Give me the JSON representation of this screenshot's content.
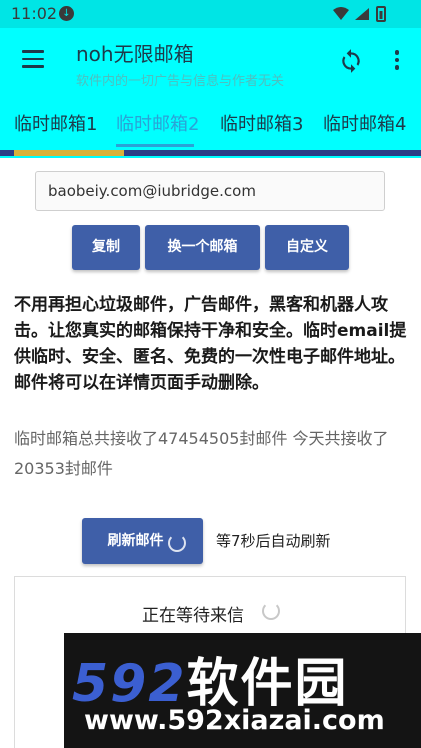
{
  "status_bar": {
    "time": "11:02"
  },
  "app_bar": {
    "title": "noh无限邮箱",
    "subtitle": "软件内的一切广告与信息与作者无关"
  },
  "tabs": [
    {
      "label": "临时邮箱1",
      "active": false
    },
    {
      "label": "临时邮箱2",
      "active": true
    },
    {
      "label": "临时邮箱3",
      "active": false
    },
    {
      "label": "临时邮箱4",
      "active": false
    }
  ],
  "email": {
    "value": "baobeiy.com@iubridge.com"
  },
  "buttons": {
    "copy": "复制",
    "change": "换一个邮箱",
    "custom": "自定义",
    "refresh": "刷新邮件"
  },
  "intro_text": "不用再担心垃圾邮件，广告邮件，黑客和机器人攻击。让您真实的邮箱保持干净和安全。临时email提供临时、安全、匿名、免费的一次性电子邮件地址。邮件将可以在详情页面手动删除。",
  "stats_text": "临时邮箱总共接收了47454505封邮件 今天共接收了20353封邮件",
  "countdown_text": "等7秒后自动刷新",
  "inbox": {
    "waiting_text": "正在等待来信"
  },
  "watermark": {
    "logo_num": "592",
    "logo_cn": "软件园",
    "url": "www.592xiazai.com"
  },
  "colors": {
    "app_bar": "#00ffff",
    "button": "#3f5fa8",
    "active_tab": "#2aa3d6",
    "indicator": "#d9b23a"
  }
}
